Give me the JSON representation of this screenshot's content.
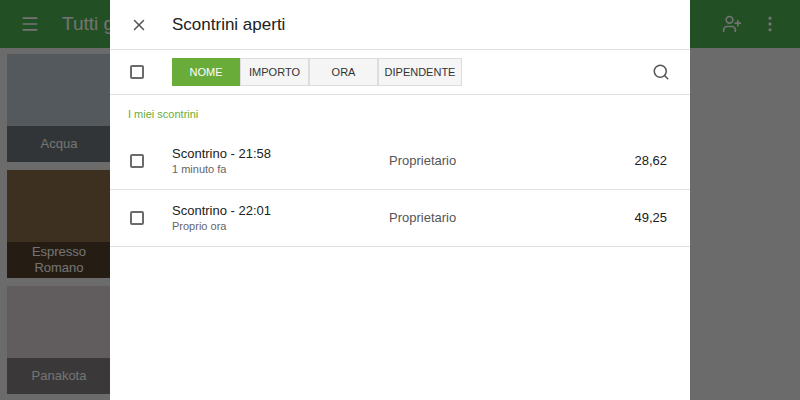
{
  "app": {
    "title": "Tutti g",
    "tiles": [
      {
        "label": "Acqua"
      },
      {
        "label": "Espresso Romano"
      },
      {
        "label": "Panakota"
      }
    ]
  },
  "dialog": {
    "title": "Scontrini aperti",
    "select_all": {
      "checked": false
    },
    "sort_buttons": [
      {
        "label": "NOME",
        "selected": true
      },
      {
        "label": "IMPORTO",
        "selected": false
      },
      {
        "label": "ORA",
        "selected": false
      },
      {
        "label": "DIPENDENTE",
        "selected": false
      }
    ],
    "section": "I miei scontrini",
    "tickets": [
      {
        "name": "Scontrino - 21:58",
        "time": "1 minuto fa",
        "employee": "Proprietario",
        "amount": "28,62",
        "checked": false
      },
      {
        "name": "Scontrino - 22:01",
        "time": "Proprio ora",
        "employee": "Proprietario",
        "amount": "49,25",
        "checked": false
      }
    ]
  }
}
